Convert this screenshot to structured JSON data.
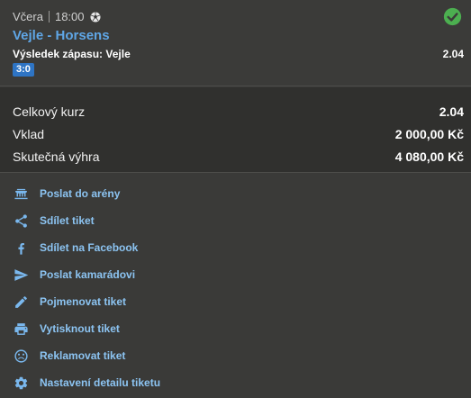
{
  "match": {
    "day": "Včera",
    "time": "18:00",
    "sport_icon": "soccer-ball-icon",
    "status_icon": "check-circle-icon",
    "status_color": "#4caf50",
    "teams": "Vejle - Horsens",
    "result_label": "Výsledek zápasu: Vejle",
    "odds": "2.04",
    "score": "3:0"
  },
  "totals": [
    {
      "label": "Celkový kurz",
      "value": "2.04"
    },
    {
      "label": "Vklad",
      "value": "2 000,00 Kč"
    },
    {
      "label": "Skutečná výhra",
      "value": "4 080,00 Kč"
    }
  ],
  "actions": [
    {
      "label": "Poslat do arény",
      "icon": "arena-icon"
    },
    {
      "label": "Sdílet tiket",
      "icon": "share-icon"
    },
    {
      "label": "Sdílet na Facebook",
      "icon": "facebook-icon"
    },
    {
      "label": "Poslat kamarádovi",
      "icon": "send-icon"
    },
    {
      "label": "Pojmenovat tiket",
      "icon": "pencil-icon"
    },
    {
      "label": "Vytisknout tiket",
      "icon": "printer-icon"
    },
    {
      "label": "Reklamovat tiket",
      "icon": "sad-face-icon"
    },
    {
      "label": "Nastavení detailu tiketu",
      "icon": "gear-icon"
    }
  ],
  "colors": {
    "accent": "#5fa6e6",
    "score_badge": "#2e74c4",
    "background": "#3a3a38"
  }
}
